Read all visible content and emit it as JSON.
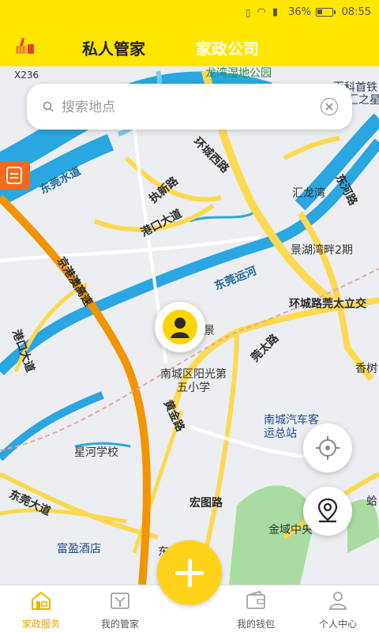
{
  "status_bar": {
    "battery": "36%",
    "time": "08:55"
  },
  "header": {
    "tabs": [
      {
        "label": "私人管家",
        "active": true
      },
      {
        "label": "家政公司",
        "active": false
      }
    ]
  },
  "search": {
    "placeholder": "搜索地点"
  },
  "map": {
    "labels": {
      "x236": "X236",
      "longwan_park": "龙湾湿地公园",
      "baike": "百科首铁",
      "zhizhi": "汇之星",
      "huanchengxi": "环城西路",
      "dongguan_water": "东莞水道",
      "jianxin": "执新路",
      "huilongwan": "汇龙湾",
      "donghe": "东河路",
      "gangkou": "港口大道",
      "jinghu": "景湖湾畔2期",
      "jinggangao": "京港澳高速",
      "dongguan_canal": "东莞运河",
      "huancheng_taili": "环城路莞太立交",
      "jing": "景",
      "guantai": "莞太路",
      "xiangshi": "香树",
      "gangkou_left": "港口大道",
      "school": "南城区阳光第五小学",
      "huangjin": "黄金路",
      "bus_station": "南城汽车客运总站",
      "xinghe": "星河学校",
      "dongguan_avenue": "东莞大道",
      "hongtu": "宏图路",
      "fuying": "富盈酒店",
      "hospital": "东莞医院",
      "jinyu": "金域中央",
      "ge": "蛤"
    }
  },
  "bottom_nav": {
    "items": [
      {
        "label": "家政服务",
        "active": true
      },
      {
        "label": "我的管家",
        "active": false
      },
      {
        "label": "我的钱包",
        "active": false
      },
      {
        "label": "个人中心",
        "active": false
      }
    ]
  },
  "colors": {
    "header_bg": "#ffe600",
    "accent": "#ffd21a",
    "active_nav": "#e7a400",
    "water": "#2aa6e0",
    "highway": "#f29400",
    "road": "#fcd94e"
  }
}
